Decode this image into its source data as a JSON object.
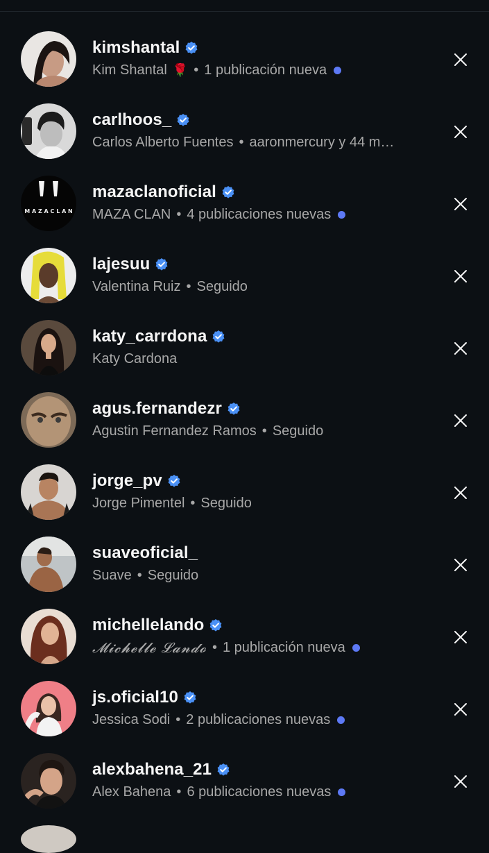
{
  "accounts": [
    {
      "username": "kimshantal",
      "verified": true,
      "full_name": "Kim Shantal",
      "emoji": "🌹",
      "status": "1 publicación nueva",
      "unread": true,
      "avatar_icon": "avatar-woman-dark-hair"
    },
    {
      "username": "carlhoos_",
      "verified": true,
      "full_name": "Carlos Alberto Fuentes",
      "emoji": "",
      "status": "aaronmercury y 44 m…",
      "unread": false,
      "avatar_icon": "avatar-man-bw"
    },
    {
      "username": "mazaclanoficial",
      "verified": true,
      "full_name": "MAZA CLAN",
      "emoji": "",
      "status": "4 publicaciones nuevas",
      "unread": true,
      "avatar_icon": "maza-clan-logo"
    },
    {
      "username": "lajesuu",
      "verified": true,
      "full_name": "Valentina Ruiz",
      "emoji": "",
      "status": "Seguido",
      "unread": false,
      "avatar_icon": "avatar-yellow-hair"
    },
    {
      "username": "katy_carrdona",
      "verified": true,
      "full_name": "Katy  Cardona",
      "emoji": "",
      "status": "",
      "unread": false,
      "avatar_icon": "avatar-woman-black-dress"
    },
    {
      "username": "agus.fernandezr",
      "verified": true,
      "full_name": "Agustin Fernandez Ramos",
      "emoji": "",
      "status": "Seguido",
      "unread": false,
      "avatar_icon": "avatar-face-closeup"
    },
    {
      "username": "jorge_pv",
      "verified": true,
      "full_name": "Jorge Pimentel",
      "emoji": "",
      "status": "Seguido",
      "unread": false,
      "avatar_icon": "avatar-man-shirtless"
    },
    {
      "username": "suaveoficial_",
      "verified": false,
      "full_name": "Suave",
      "emoji": "",
      "status": "Seguido",
      "unread": false,
      "avatar_icon": "avatar-man-outdoors"
    },
    {
      "username": "michellelando",
      "verified": true,
      "full_name": "𝓜𝓲𝓬𝓱𝓮𝓵𝓵𝓮 𝓛𝓪𝓷𝓭𝓸",
      "emoji": "",
      "status": "1 publicación nueva",
      "unread": true,
      "avatar_icon": "avatar-woman-red-hair",
      "script": true
    },
    {
      "username": "js.oficial10",
      "verified": true,
      "full_name": "Jessica Sodi",
      "emoji": "",
      "status": "2 publicaciones nuevas",
      "unread": true,
      "avatar_icon": "avatar-woman-pink-bg"
    },
    {
      "username": "alexbahena_21",
      "verified": true,
      "full_name": "Alex Bahena",
      "emoji": "",
      "status": "6 publicaciones nuevas",
      "unread": true,
      "avatar_icon": "avatar-young-man"
    }
  ],
  "colors": {
    "background": "#0c1014",
    "verified": "#4a90f5",
    "unread_dot": "#5d79f5",
    "secondary_text": "#a8a8a8"
  },
  "icons": {
    "verified": "verified-badge-icon",
    "dismiss": "close-icon"
  }
}
